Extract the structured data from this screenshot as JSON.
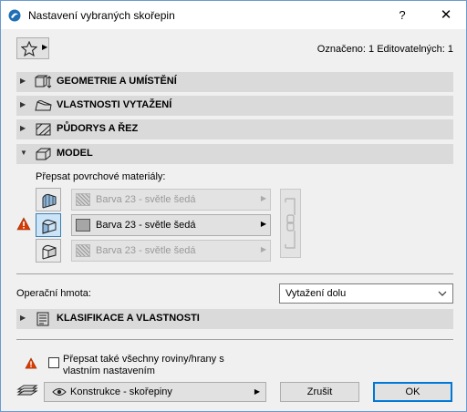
{
  "window": {
    "title": "Nastavení vybraných skořepin",
    "help_label": "?",
    "close_label": "✕"
  },
  "toolbar": {
    "favorites_icon": "star-icon",
    "selection_info": "Označeno: 1 Editovatelných: 1"
  },
  "sections": [
    {
      "label": "GEOMETRIE A UMÍSTĚNÍ",
      "icon": "geometry-icon",
      "expanded": false
    },
    {
      "label": "VLASTNOSTI VYTAŽENÍ",
      "icon": "extrusion-icon",
      "expanded": false
    },
    {
      "label": "PŮDORYS A ŘEZ",
      "icon": "floorplan-section-icon",
      "expanded": false
    },
    {
      "label": "MODEL",
      "icon": "model-icon",
      "expanded": true
    },
    {
      "label": "KLASIFIKACE A VLASTNOSTI",
      "icon": "classification-icon",
      "expanded": false
    }
  ],
  "model": {
    "override_label": "Přepsat povrchové materiály:",
    "materials": [
      {
        "name": "Barva 23 - světle šedá",
        "enabled": false
      },
      {
        "name": "Barva 23 - světle šedá",
        "enabled": true
      },
      {
        "name": "Barva 23 - světle šedá",
        "enabled": false
      }
    ]
  },
  "operation": {
    "label": "Operační hmota:",
    "value": "Vytažení dolu"
  },
  "footer": {
    "override_all_label": "Přepsat také všechny roviny/hrany s vlastním nastavením",
    "override_all_checked": false,
    "layer_value": "Konstrukce - skořepiny",
    "cancel_label": "Zrušit",
    "ok_label": "OK"
  },
  "colors": {
    "accent": "#0078d7",
    "section_bg": "#dadada",
    "warning": "#d83b01"
  }
}
